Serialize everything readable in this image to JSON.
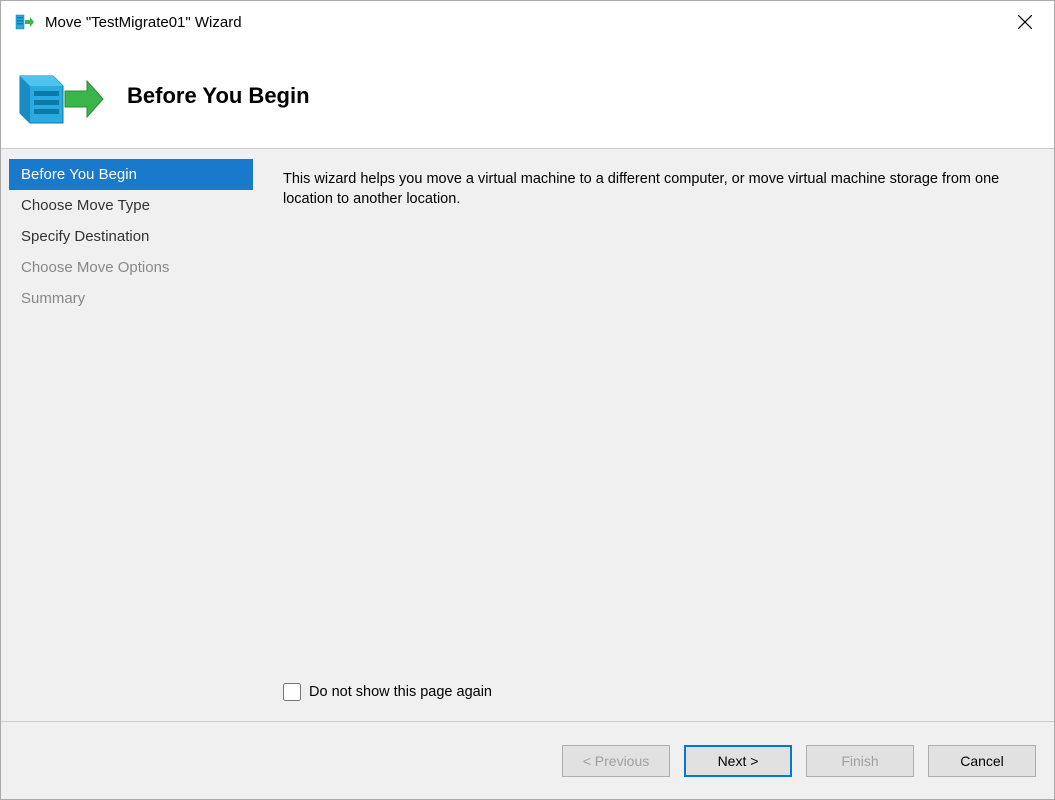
{
  "window": {
    "title": "Move \"TestMigrate01\" Wizard"
  },
  "header": {
    "title": "Before You Begin"
  },
  "sidebar": {
    "items": [
      {
        "label": "Before You Begin",
        "state": "active"
      },
      {
        "label": "Choose Move Type",
        "state": "normal"
      },
      {
        "label": "Specify Destination",
        "state": "normal"
      },
      {
        "label": "Choose Move Options",
        "state": "disabled"
      },
      {
        "label": "Summary",
        "state": "disabled"
      }
    ]
  },
  "content": {
    "description": "This wizard helps you move a virtual machine to a different computer, or move virtual machine storage from one location to another location.",
    "checkbox_label": "Do not show this page again"
  },
  "footer": {
    "previous": "< Previous",
    "next": "Next >",
    "finish": "Finish",
    "cancel": "Cancel"
  }
}
